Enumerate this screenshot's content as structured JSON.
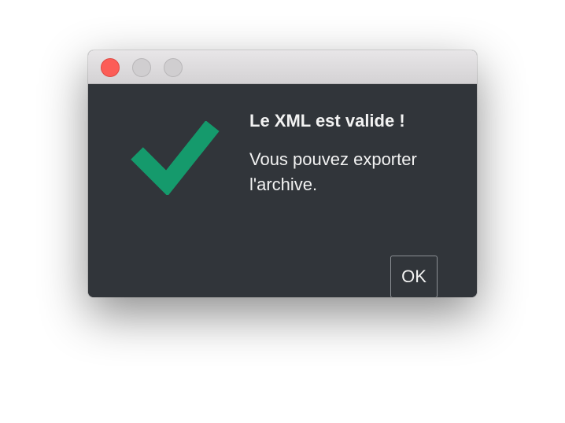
{
  "dialog": {
    "title": "Le XML est valide !",
    "message": "Vous pouvez exporter l'archive.",
    "ok_label": "OK",
    "icon": "checkmark-icon"
  },
  "titlebar": {
    "buttons": [
      "close",
      "minimize",
      "maximize"
    ]
  },
  "colors": {
    "background": "#31353a",
    "check": "#159a6c",
    "text": "#f2f2f2",
    "close": "#fc5d57"
  }
}
